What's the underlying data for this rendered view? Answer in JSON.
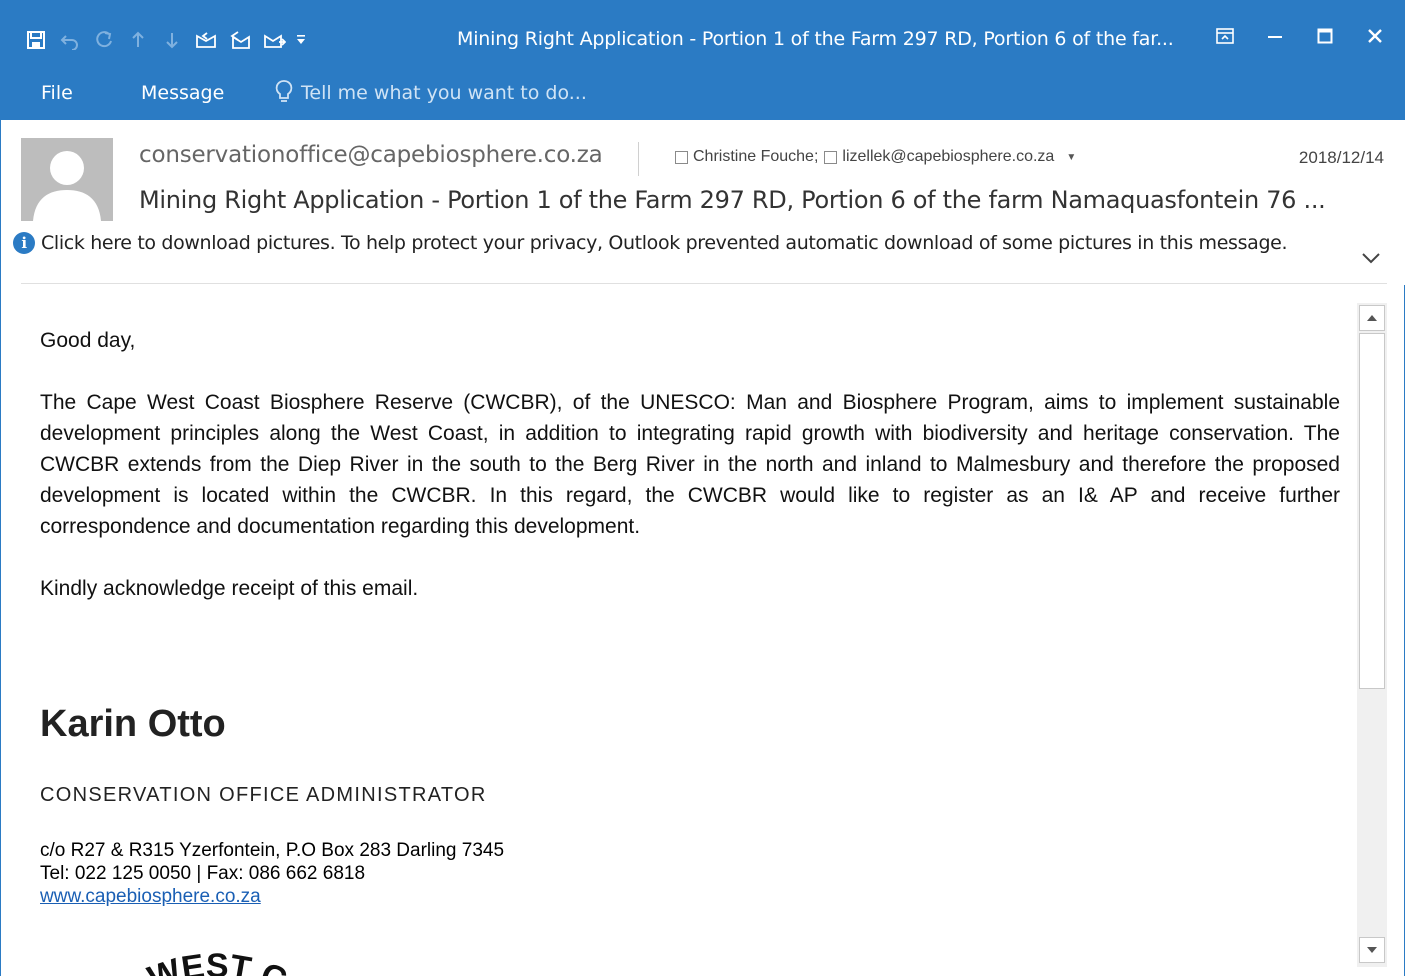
{
  "window": {
    "title": "Mining Right Application - Portion 1 of the Farm 297 RD, Portion 6 of the far...",
    "accent_color": "#2b7bc4",
    "quick_access_icons": [
      "save-icon",
      "undo-icon",
      "redo-icon",
      "previous-item-icon",
      "next-item-icon",
      "reply-icon",
      "reply-all-icon",
      "forward-icon",
      "customize-dropdown-icon"
    ],
    "controls": [
      "ribbon-display-icon",
      "minimize-icon",
      "maximize-icon",
      "close-icon"
    ]
  },
  "ribbon": {
    "tabs": [
      {
        "label": "File"
      },
      {
        "label": "Message"
      }
    ],
    "tell_me_placeholder": "Tell me what you want to do..."
  },
  "header": {
    "from": "conservationoffice@capebiosphere.co.za",
    "recipients": [
      "Christine Fouche;",
      "lizellek@capebiosphere.co.za"
    ],
    "date": "2018/12/14",
    "subject": "Mining Right Application - Portion 1 of the Farm 297 RD, Portion 6 of the farm Namaquasfontein 76 ...",
    "info_bar": "Click here to download pictures. To help protect your privacy, Outlook prevented automatic download of some pictures in this message."
  },
  "body": {
    "greeting": "Good day,",
    "paragraph": "The Cape West Coast Biosphere Reserve (CWCBR), of the UNESCO: Man and Biosphere Program, aims to implement sustainable development principles along the West Coast, in addition to integrating rapid growth with biodiversity and heritage conservation. The CWCBR extends from the Diep River in the south to the Berg River in the north and inland to Malmesbury and therefore the proposed development is located within the CWCBR. In this regard, the CWCBR would like to register as an I& AP and receive further correspondence and documentation regarding this development.",
    "closing": "Kindly acknowledge receipt of this email.",
    "signature": {
      "name": "Karin Otto",
      "role": "CONSERVATION OFFICE ADMINISTRATOR",
      "address": "c/o R27 & R315 Yzerfontein, P.O Box 283 Darling 7345",
      "phone": "Tel: 022 125 0050 | Fax: 086 662 6818",
      "website": "www.capebiosphere.co.za",
      "logo_text": "WEST C"
    }
  }
}
